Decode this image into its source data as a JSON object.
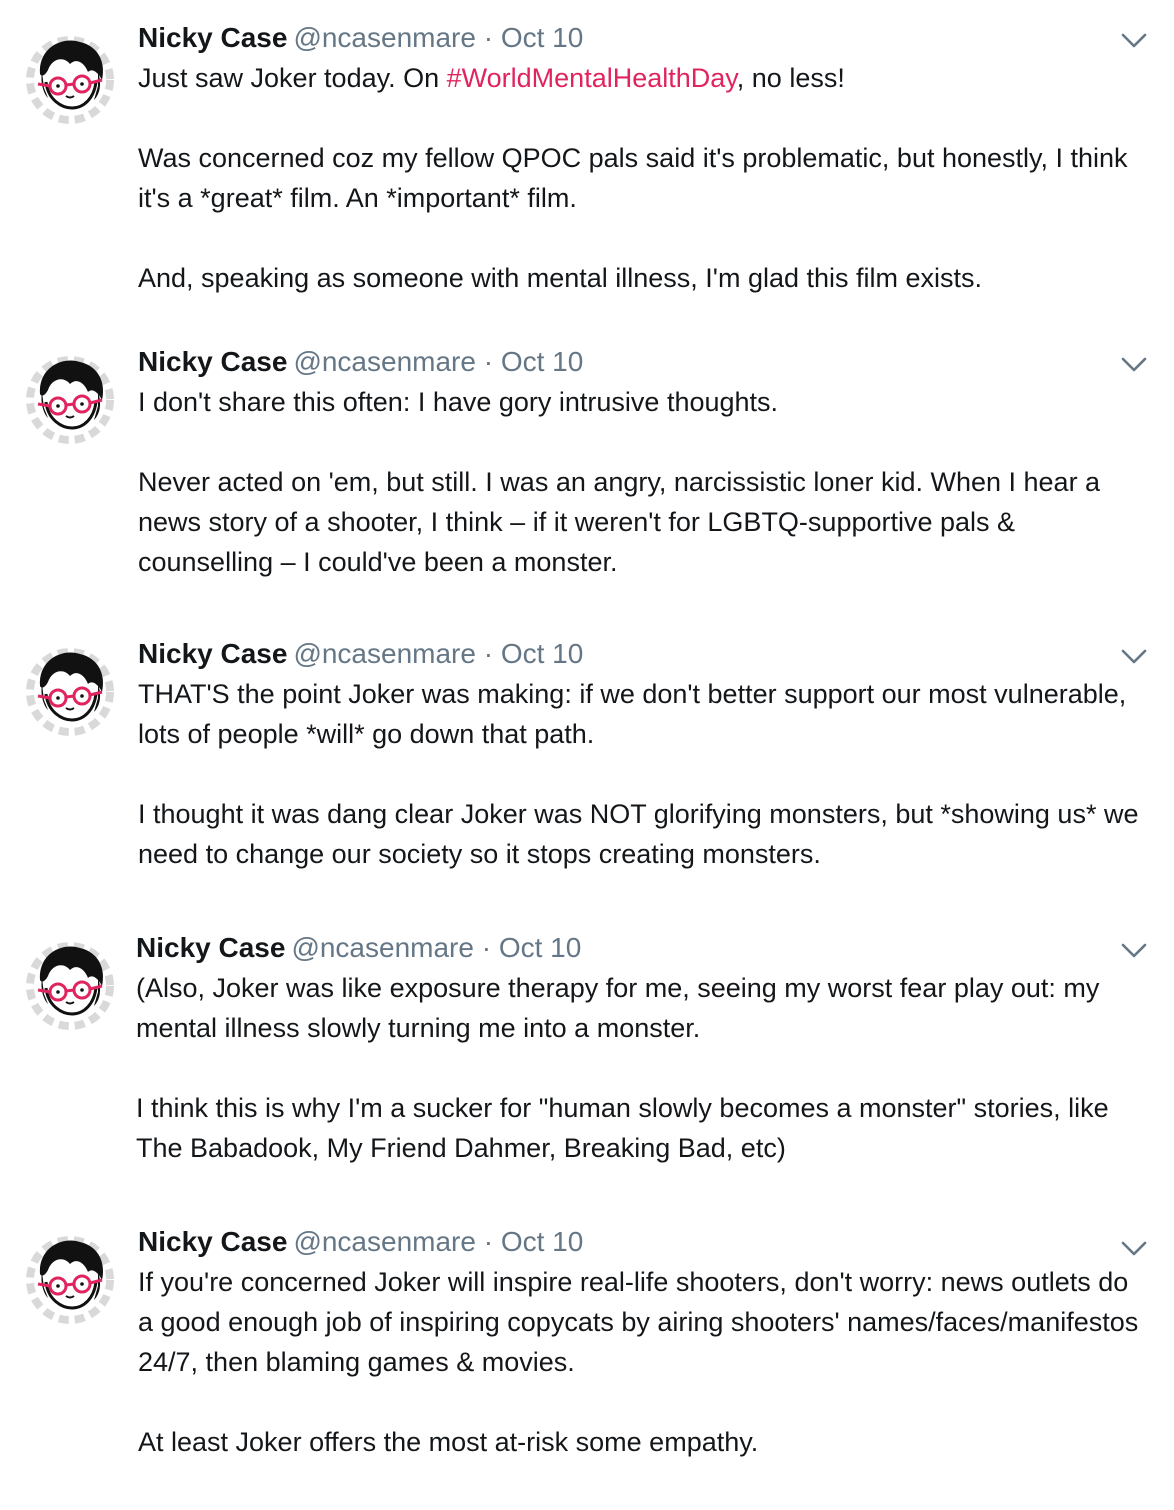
{
  "author": {
    "name": "Nicky Case",
    "handle": "@ncasenmare",
    "separator": "·",
    "avatar_icon": "nicky-case-avatar-icon"
  },
  "colors": {
    "hashtag": "#e0245e",
    "muted": "#657786",
    "text": "#14171a"
  },
  "tweets": [
    {
      "date": "Oct 10",
      "p1_before": "Just saw Joker today. On ",
      "p1_hashtag": "#WorldMentalHealthDay",
      "p1_after": ", no less!",
      "p2": "Was concerned coz my fellow QPOC pals said it's problematic, but honestly, I think it's a *great* film. An *important* film.",
      "p3": "And, speaking as someone with mental illness, I'm glad this film exists."
    },
    {
      "date": "Oct 10",
      "p1": "I don't share this often: I have gory intrusive thoughts.",
      "p2": "Never acted on 'em, but still. I was an angry, narcissistic loner kid. When I hear a news story of a shooter, I think – if it weren't for LGBTQ-supportive pals & counselling – I could've been a monster."
    },
    {
      "date": "Oct 10",
      "p1": "THAT'S the point Joker was making: if we don't better support our most vulnerable, lots of people *will* go down that path.",
      "p2": "I thought it was dang clear Joker was NOT glorifying monsters, but *showing us* we need to change our society so it stops creating monsters."
    },
    {
      "date": "Oct 10",
      "p1": "(Also, Joker was like exposure therapy for me, seeing my worst fear play out: my mental illness slowly turning me into a monster.",
      "p2": "I think this is why I'm a sucker for \"human slowly becomes a monster\" stories, like The Babadook, My Friend Dahmer, Breaking Bad, etc)"
    },
    {
      "date": "Oct 10",
      "p1": "If you're concerned Joker will inspire real-life shooters, don't worry: news outlets do a good enough job of inspiring copycats by airing shooters' names/faces/manifestos 24/7, then blaming games & movies.",
      "p2": "At least Joker offers the most at-risk some empathy."
    }
  ]
}
